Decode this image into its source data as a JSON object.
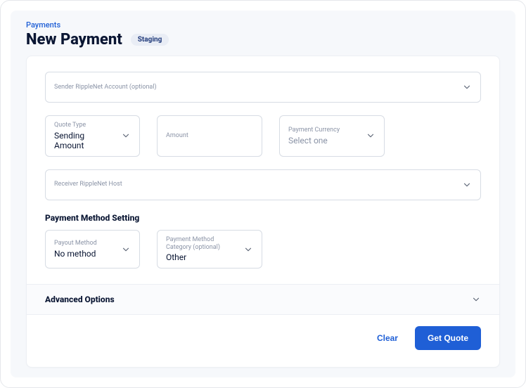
{
  "breadcrumb": "Payments",
  "title": "New Payment",
  "env_badge": "Staging",
  "fields": {
    "sender_account": {
      "label": "Sender RippleNet Account (optional)",
      "value": ""
    },
    "quote_type": {
      "label": "Quote Type",
      "value": "Sending Amount"
    },
    "amount": {
      "label": "Amount",
      "value": ""
    },
    "payment_currency": {
      "label": "Payment Currency",
      "value": "Select one"
    },
    "receiver_host": {
      "label": "Receiver RippleNet Host",
      "value": ""
    }
  },
  "payment_method_section": {
    "heading": "Payment Method Setting",
    "payout_method": {
      "label": "Payout Method",
      "value": "No method"
    },
    "payment_method_category": {
      "label": "Payment Method Category (optional)",
      "value": "Other"
    }
  },
  "advanced": {
    "heading": "Advanced Options"
  },
  "footer": {
    "clear": "Clear",
    "submit": "Get Quote"
  }
}
